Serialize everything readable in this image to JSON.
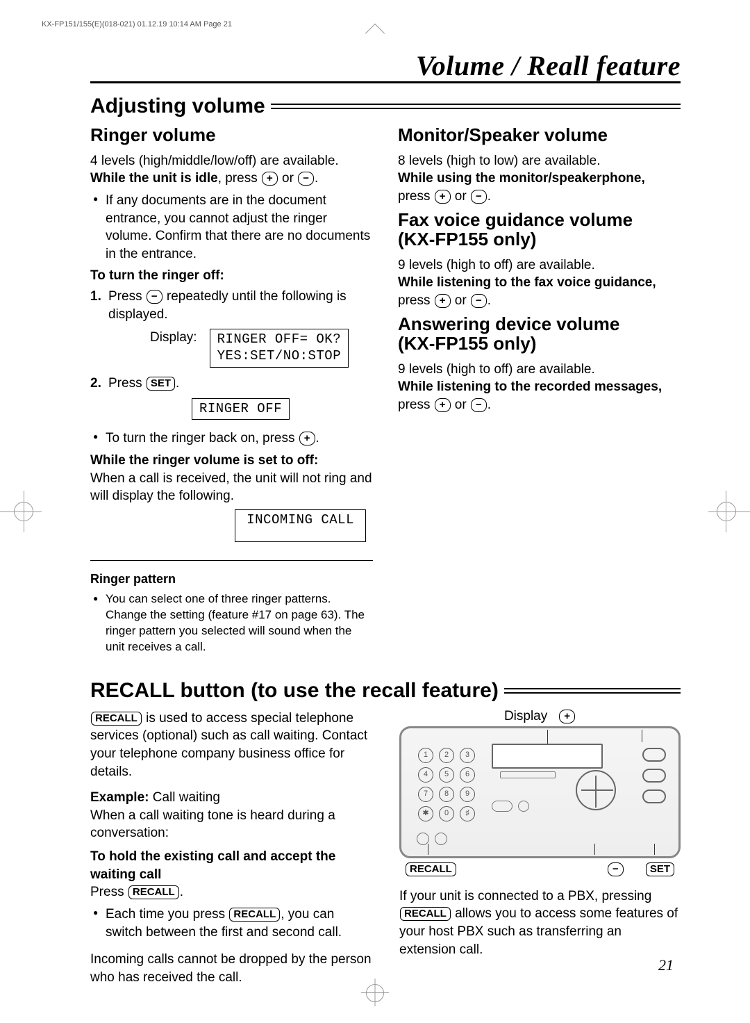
{
  "crop_header": "KX-FP151/155(E)(018-021)  01.12.19 10:14 AM  Page 21",
  "page_title": "Volume / Reall feature",
  "page_number": "21",
  "sections": {
    "adjusting": {
      "heading": "Adjusting volume",
      "ringer": {
        "heading": "Ringer volume",
        "intro": "4 levels (high/middle/low/off) are available.",
        "idle_prefix": "While the unit is idle",
        "idle_suffix": ", press ",
        "or": " or ",
        "period": ".",
        "note1": "If any documents are in the document entrance, you cannot adjust the ringer volume. Confirm that there are no documents in the entrance.",
        "turn_off_head": "To turn the ringer off:",
        "step1a": "Press ",
        "step1b": " repeatedly until the following is displayed.",
        "display_label": "Display:",
        "lcd1": "RINGER OFF= OK?\nYES:SET/NO:STOP",
        "step2a": "Press ",
        "lcd2": "RINGER OFF",
        "back_on_a": "To turn the ringer back on, press ",
        "set_off_head": "While the ringer volume is set to off:",
        "set_off_body": "When a call is received, the unit will not ring and will display the following.",
        "lcd3": "INCOMING CALL",
        "pattern_head": "Ringer pattern",
        "pattern_body": "You can select one of three ringer patterns. Change the setting (feature #17 on page 63). The ringer pattern you selected will sound when the unit receives a call."
      },
      "monitor": {
        "heading": "Monitor/Speaker volume",
        "line1": "8 levels (high to low) are available.",
        "bold": "While using the monitor/speakerphone,",
        "press": "press "
      },
      "faxvoice": {
        "heading": "Fax voice guidance volume\n(KX-FP155 only)",
        "line1": "9 levels (high to off) are available.",
        "bold": "While listening to the fax voice guidance,",
        "press": " press "
      },
      "answering": {
        "heading": "Answering device volume\n(KX-FP155 only)",
        "line1": "9 levels (high to off) are available.",
        "bold": "While listening to the recorded messages,",
        "press": " press "
      }
    },
    "recall": {
      "heading": "RECALL button (to use the recall feature)",
      "p1a": " is used to access special telephone services (optional) such as call waiting. Contact your telephone company business office for details.",
      "example_label": "Example:",
      "example_text": " Call waiting",
      "example_body": "When a call waiting tone is heard during a conversation:",
      "hold_head": "To hold the existing call and accept the waiting call",
      "press_label": "Press ",
      "each_a": "Each time you press ",
      "each_b": ", you can switch between the first and second call.",
      "drop": "Incoming calls cannot be dropped by the person who has received the call.",
      "labels": {
        "display": "Display",
        "recall": "RECALL",
        "set": "SET"
      },
      "pbx_a": "If your unit is connected to a PBX, pressing ",
      "pbx_b": " allows you to access some features of your host PBX such as transferring an extension call."
    }
  },
  "keys": {
    "plus": "+",
    "minus": "−",
    "set": "SET",
    "recall": "RECALL"
  }
}
